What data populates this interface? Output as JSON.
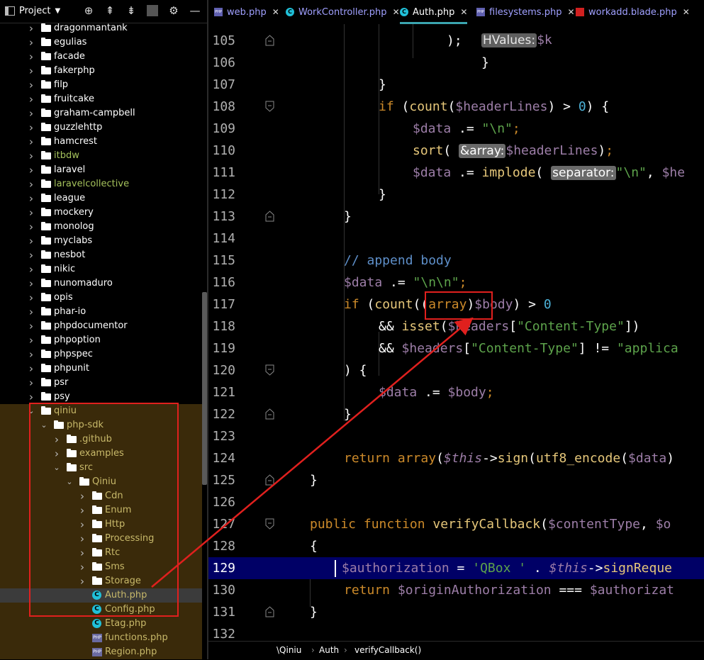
{
  "project_panel": {
    "title": "Project",
    "toolbar_icons": [
      "crosshair-icon",
      "collapse-all-icon",
      "expand-icon",
      "gear-icon",
      "minimize-icon"
    ],
    "tree": [
      {
        "label": "dragonmantank",
        "type": "folder",
        "state": "collapsed",
        "color": "white"
      },
      {
        "label": "egulias",
        "type": "folder",
        "state": "collapsed",
        "color": "white"
      },
      {
        "label": "facade",
        "type": "folder",
        "state": "collapsed",
        "color": "white"
      },
      {
        "label": "fakerphp",
        "type": "folder",
        "state": "collapsed",
        "color": "white"
      },
      {
        "label": "filp",
        "type": "folder",
        "state": "collapsed",
        "color": "white"
      },
      {
        "label": "fruitcake",
        "type": "folder",
        "state": "collapsed",
        "color": "white"
      },
      {
        "label": "graham-campbell",
        "type": "folder",
        "state": "collapsed",
        "color": "white"
      },
      {
        "label": "guzzlehttp",
        "type": "folder",
        "state": "collapsed",
        "color": "white"
      },
      {
        "label": "hamcrest",
        "type": "folder",
        "state": "collapsed",
        "color": "white"
      },
      {
        "label": "itbdw",
        "type": "folder",
        "state": "collapsed",
        "color": "green"
      },
      {
        "label": "laravel",
        "type": "folder",
        "state": "collapsed",
        "color": "white"
      },
      {
        "label": "laravelcollective",
        "type": "folder",
        "state": "collapsed",
        "color": "green"
      },
      {
        "label": "league",
        "type": "folder",
        "state": "collapsed",
        "color": "white"
      },
      {
        "label": "mockery",
        "type": "folder",
        "state": "collapsed",
        "color": "white"
      },
      {
        "label": "monolog",
        "type": "folder",
        "state": "collapsed",
        "color": "white"
      },
      {
        "label": "myclabs",
        "type": "folder",
        "state": "collapsed",
        "color": "white"
      },
      {
        "label": "nesbot",
        "type": "folder",
        "state": "collapsed",
        "color": "white"
      },
      {
        "label": "nikic",
        "type": "folder",
        "state": "collapsed",
        "color": "white"
      },
      {
        "label": "nunomaduro",
        "type": "folder",
        "state": "collapsed",
        "color": "white"
      },
      {
        "label": "opis",
        "type": "folder",
        "state": "collapsed",
        "color": "white"
      },
      {
        "label": "phar-io",
        "type": "folder",
        "state": "collapsed",
        "color": "white"
      },
      {
        "label": "phpdocumentor",
        "type": "folder",
        "state": "collapsed",
        "color": "white"
      },
      {
        "label": "phpoption",
        "type": "folder",
        "state": "collapsed",
        "color": "white"
      },
      {
        "label": "phpspec",
        "type": "folder",
        "state": "collapsed",
        "color": "white"
      },
      {
        "label": "phpunit",
        "type": "folder",
        "state": "collapsed",
        "color": "white"
      },
      {
        "label": "psr",
        "type": "folder",
        "state": "collapsed",
        "color": "white"
      },
      {
        "label": "psy",
        "type": "folder",
        "state": "collapsed",
        "color": "white"
      },
      {
        "label": "qiniu",
        "type": "folder",
        "state": "expanded",
        "color": "yellow"
      },
      {
        "label": "php-sdk",
        "type": "folder",
        "state": "expanded",
        "color": "yellow"
      },
      {
        "label": ".github",
        "type": "folder",
        "state": "collapsed",
        "color": "yellow"
      },
      {
        "label": "examples",
        "type": "folder",
        "state": "collapsed",
        "color": "yellow"
      },
      {
        "label": "src",
        "type": "folder",
        "state": "expanded",
        "color": "yellow"
      },
      {
        "label": "Qiniu",
        "type": "folder",
        "state": "expanded",
        "color": "yellow"
      },
      {
        "label": "Cdn",
        "type": "folder",
        "state": "collapsed",
        "color": "yellow"
      },
      {
        "label": "Enum",
        "type": "folder",
        "state": "collapsed",
        "color": "yellow"
      },
      {
        "label": "Http",
        "type": "folder",
        "state": "collapsed",
        "color": "yellow"
      },
      {
        "label": "Processing",
        "type": "folder",
        "state": "collapsed",
        "color": "yellow"
      },
      {
        "label": "Rtc",
        "type": "folder",
        "state": "collapsed",
        "color": "yellow"
      },
      {
        "label": "Sms",
        "type": "folder",
        "state": "collapsed",
        "color": "yellow"
      },
      {
        "label": "Storage",
        "type": "folder",
        "state": "collapsed",
        "color": "yellow"
      },
      {
        "label": "Auth.php",
        "type": "class",
        "state": "selected",
        "color": "yellow"
      },
      {
        "label": "Config.php",
        "type": "class",
        "state": "none",
        "color": "yellow"
      },
      {
        "label": "Etag.php",
        "type": "class",
        "state": "none",
        "color": "yellow"
      },
      {
        "label": "functions.php",
        "type": "php",
        "state": "none",
        "color": "yellow"
      },
      {
        "label": "Region.php",
        "type": "php",
        "state": "none",
        "color": "yellow"
      }
    ]
  },
  "tabs": [
    {
      "label": "web.php",
      "icon": "php-file-icon",
      "active": false
    },
    {
      "label": "WorkController.php",
      "icon": "php-class-icon",
      "active": false
    },
    {
      "label": "Auth.php",
      "icon": "php-class-icon",
      "active": true
    },
    {
      "label": "filesystems.php",
      "icon": "php-file-icon",
      "active": false
    },
    {
      "label": "workadd.blade.php",
      "icon": "blade-file-icon",
      "active": false
    }
  ],
  "editor": {
    "top_partial": "      );",
    "current_line": "129",
    "lines": [
      {
        "n": "105"
      },
      {
        "n": "106"
      },
      {
        "n": "107"
      },
      {
        "n": "108"
      },
      {
        "n": "109"
      },
      {
        "n": "110"
      },
      {
        "n": "111"
      },
      {
        "n": "112"
      },
      {
        "n": "113"
      },
      {
        "n": "114"
      },
      {
        "n": "115"
      },
      {
        "n": "116"
      },
      {
        "n": "117"
      },
      {
        "n": "118"
      },
      {
        "n": "119"
      },
      {
        "n": "120"
      },
      {
        "n": "121"
      },
      {
        "n": "122"
      },
      {
        "n": "123"
      },
      {
        "n": "124"
      },
      {
        "n": "125"
      },
      {
        "n": "126"
      },
      {
        "n": "127"
      },
      {
        "n": "128"
      },
      {
        "n": "129"
      },
      {
        "n": "130"
      },
      {
        "n": "131"
      },
      {
        "n": "132"
      }
    ],
    "tokens": {
      "if": "if",
      "count": "count",
      "headerLines": "$headerLines",
      "zero": "0",
      "data": "$data",
      "concat": ".=",
      "newline": "\"\\n\"",
      "sort": "sort",
      "hint_array": "&array:",
      "implode": "implode",
      "hint_separator": "separator:",
      "comment": "// append body",
      "dbl_newline": "\"\\n\\n\"",
      "cast_array": "array",
      "body": "$body",
      "isset": "isset",
      "headers": "$headers",
      "content_type": "\"Content-Type\"",
      "applica": "\"applica",
      "return": "return",
      "array_fn": "array",
      "this": "$this",
      "sign": "sign",
      "utf8": "utf8_encode",
      "public": "public",
      "function": "function",
      "verifyCallback": "verifyCallback",
      "contentType": "$contentType",
      "authorization": "$authorization",
      "qbox": "'QBox '",
      "signReque": "signReque",
      "originAuth": "$originAuthorization",
      "authorizat": "$authorizat"
    }
  },
  "breadcrumb": [
    "\\Qiniu",
    "Auth",
    "verifyCallback()"
  ],
  "colors": {
    "keyword": "#cc8a2a",
    "variable": "#9d7ea8",
    "function": "#e6c77a",
    "string": "#5da34b",
    "number": "#4db2d8",
    "comment": "#5e8fc9",
    "current_line_bg": "#000066",
    "annotation_red": "#e0201e"
  }
}
